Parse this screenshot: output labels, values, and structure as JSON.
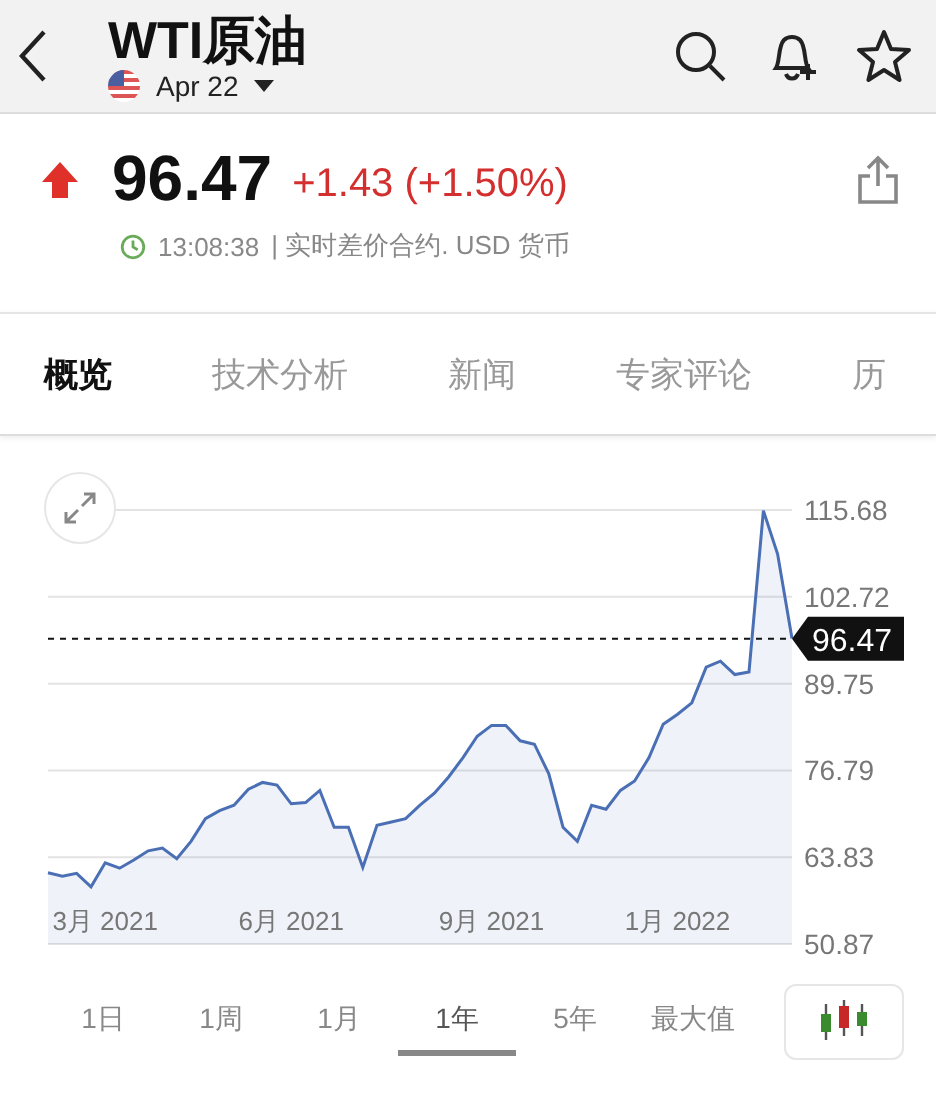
{
  "header": {
    "title": "WTI原油",
    "contract": "Apr 22"
  },
  "quote": {
    "price": "96.47",
    "change": "+1.43 (+1.50%)",
    "up": true,
    "time": "13:08:38",
    "info": "| 实时差价合约. USD 货币"
  },
  "tabs": [
    {
      "label": "概览",
      "selected": true
    },
    {
      "label": "技术分析",
      "selected": false
    },
    {
      "label": "新闻",
      "selected": false
    },
    {
      "label": "专家评论",
      "selected": false
    },
    {
      "label": "历",
      "selected": false
    }
  ],
  "chart": {
    "chart_data": {
      "type": "area",
      "grid": true,
      "ref_lines": [
        {
          "axis": "y",
          "value": 96.47,
          "label": "96.47",
          "color": "#111111"
        }
      ],
      "categories": [
        null,
        null,
        null,
        null,
        "3月 2021",
        null,
        null,
        null,
        null,
        null,
        null,
        null,
        null,
        null,
        null,
        null,
        null,
        "6月 2021",
        null,
        null,
        null,
        null,
        null,
        null,
        null,
        null,
        null,
        null,
        null,
        null,
        null,
        "9月 2021",
        null,
        null,
        null,
        null,
        null,
        null,
        null,
        null,
        null,
        null,
        null,
        null,
        "1月 2022",
        null,
        null,
        null,
        null,
        null,
        null,
        null,
        null
      ],
      "series": [
        {
          "color": "#4a6fb5",
          "values": [
            61.5,
            61.0,
            61.4,
            59.4,
            63.0,
            62.2,
            63.4,
            64.8,
            65.2,
            63.6,
            66.2,
            69.6,
            70.8,
            71.6,
            74.0,
            75.0,
            74.6,
            71.8,
            72.0,
            73.8,
            68.3,
            68.3,
            62.3,
            68.6,
            69.1,
            69.6,
            71.6,
            73.4,
            75.8,
            78.7,
            81.9,
            83.5,
            83.5,
            81.2,
            80.7,
            76.3,
            68.3,
            66.2,
            71.6,
            71.0,
            73.8,
            75.2,
            78.7,
            83.7,
            85.2,
            86.9,
            92.2,
            93.1,
            91.1,
            91.5,
            115.6,
            109.1,
            96.5
          ]
        }
      ],
      "ylim": [
        50.87,
        115.68
      ],
      "yticks": [
        {
          "value": 115.68,
          "label": "115.68"
        },
        {
          "value": 102.72,
          "label": "102.72"
        },
        {
          "value": 89.75,
          "label": "89.75"
        },
        {
          "value": 76.79,
          "label": "76.79"
        },
        {
          "value": 63.83,
          "label": "63.83"
        },
        {
          "value": 50.87,
          "label": "50.87"
        }
      ]
    }
  },
  "ranges": [
    {
      "label": "1日",
      "selected": false
    },
    {
      "label": "1周",
      "selected": false
    },
    {
      "label": "1月",
      "selected": false
    },
    {
      "label": "1年",
      "selected": true
    },
    {
      "label": "5年",
      "selected": false
    },
    {
      "label": "最大值",
      "selected": false
    }
  ]
}
